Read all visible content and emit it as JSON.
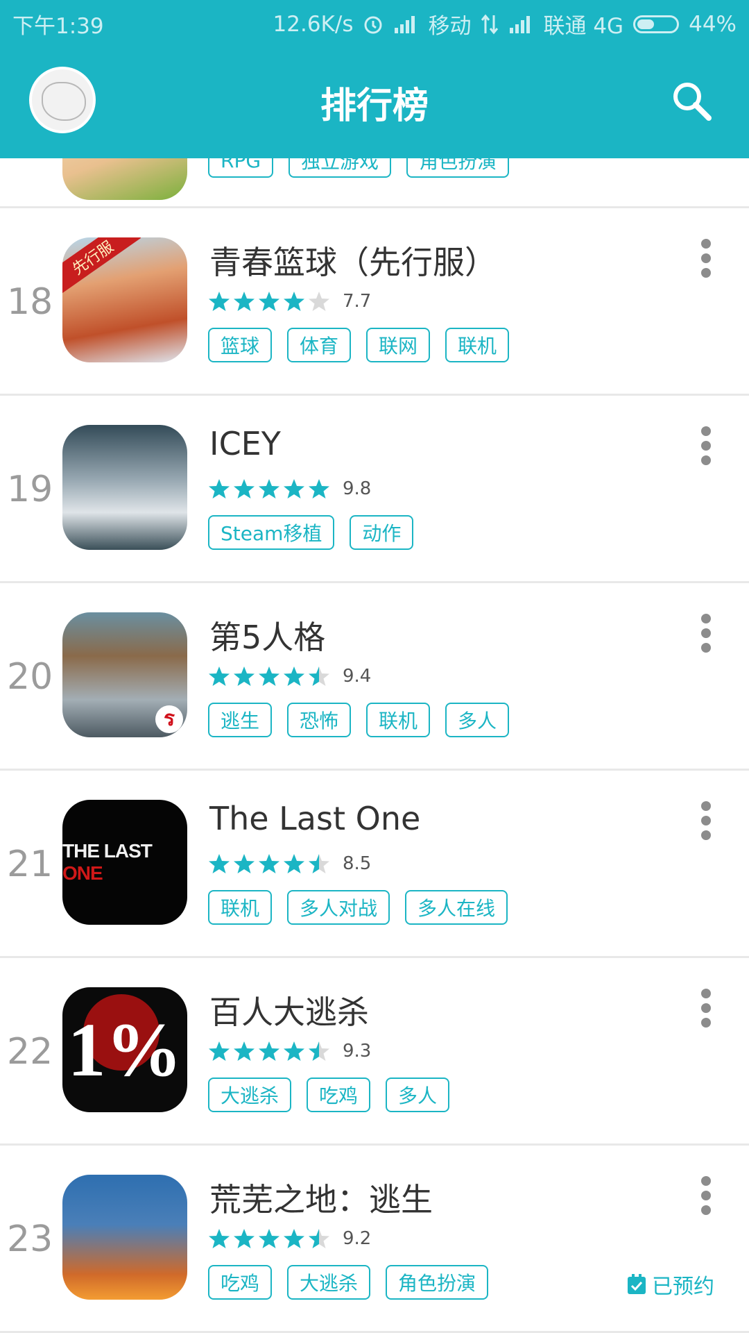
{
  "status_bar": {
    "time": "下午1:39",
    "net_speed": "12.6K/s",
    "carrier1": "移动",
    "carrier2": "联通 4G",
    "battery": "44%",
    "battery_level": 0.44
  },
  "app_bar": {
    "title": "排行榜"
  },
  "partial_row": {
    "tags": [
      "RPG",
      "独立游戏",
      "角色扮演"
    ]
  },
  "rows": [
    {
      "rank": "18",
      "name": "青春篮球（先行服）",
      "score": "7.7",
      "rating": 4.0,
      "tags": [
        "篮球",
        "体育",
        "联网",
        "联机"
      ],
      "icon_badge": "先行服"
    },
    {
      "rank": "19",
      "name": "ICEY",
      "score": "9.8",
      "rating": 5.0,
      "tags": [
        "Steam移植",
        "动作"
      ]
    },
    {
      "rank": "20",
      "name": "第5人格",
      "score": "9.4",
      "rating": 4.5,
      "tags": [
        "逃生",
        "恐怖",
        "联机",
        "多人"
      ]
    },
    {
      "rank": "21",
      "name": "The Last One",
      "score": "8.5",
      "rating": 4.5,
      "tags": [
        "联机",
        "多人对战",
        "多人在线"
      ],
      "icon_text": "THE LAST ONE"
    },
    {
      "rank": "22",
      "name": "百人大逃杀",
      "score": "9.3",
      "rating": 4.5,
      "tags": [
        "大逃杀",
        "吃鸡",
        "多人"
      ],
      "icon_text": "1%"
    },
    {
      "rank": "23",
      "name": "荒芜之地：逃生",
      "score": "9.2",
      "rating": 4.5,
      "tags": [
        "吃鸡",
        "大逃杀",
        "角色扮演"
      ],
      "status": "已预约"
    }
  ],
  "colors": {
    "accent": "#1bb5c4",
    "star_empty": "#d9d9d9"
  }
}
